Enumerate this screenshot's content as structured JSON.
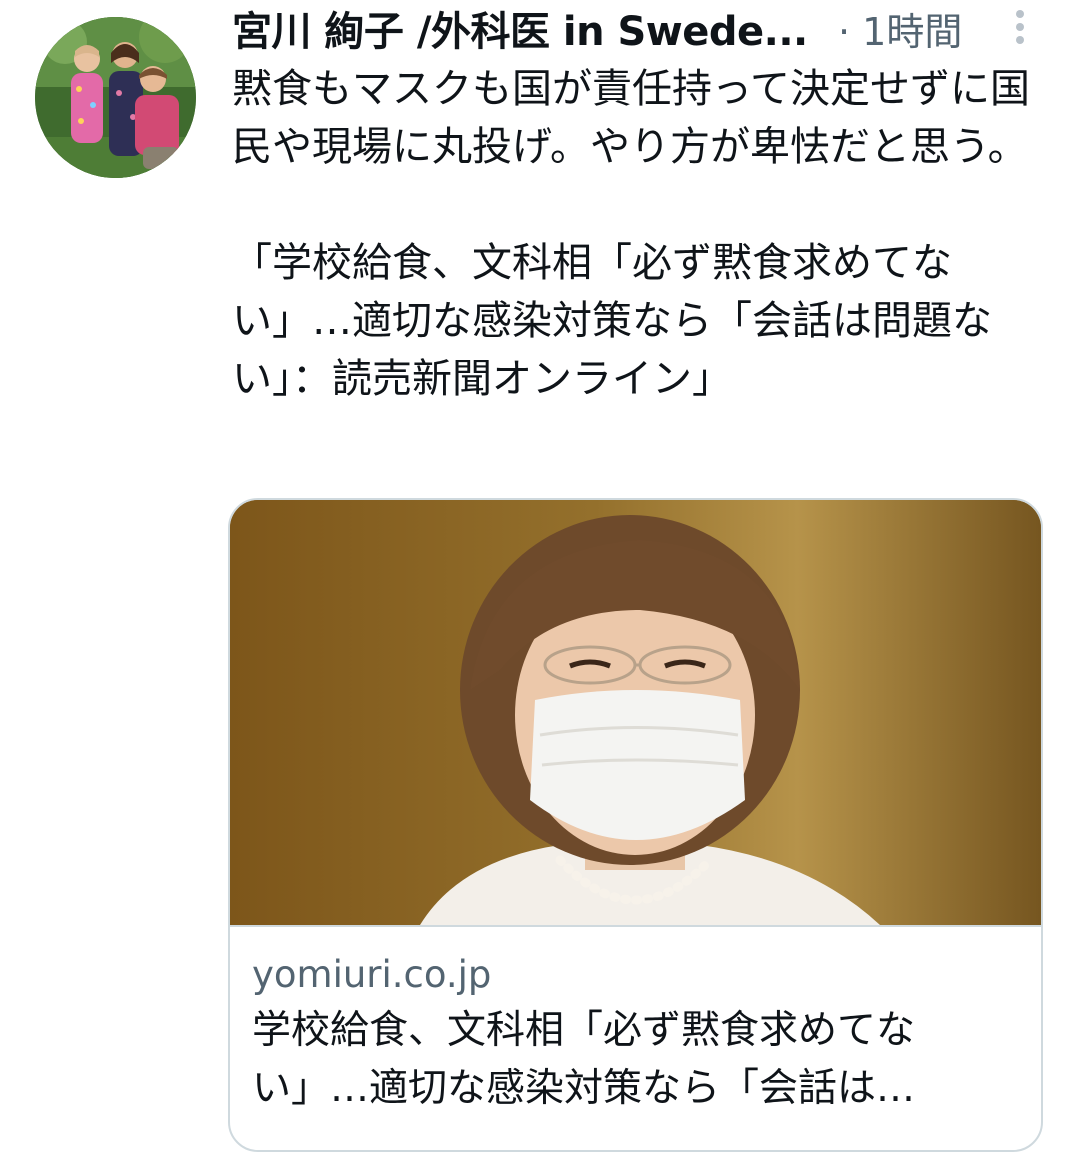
{
  "author": {
    "display_name": "宮川 絢子 /外科医 in Swede...",
    "timestamp": "· 1時間"
  },
  "tweet": {
    "line_1": "黙食もマスクも国が責任持って決定せずに国民や現場に丸投げ。やり方が卑怯だと思う。",
    "line_2": "「学校給食、文科相「必ず黙食求めてない」…適切な感染対策なら「会話は問題ない」：読売新聞オンライン」"
  },
  "card": {
    "domain": "yomiuri.co.jp",
    "title": "学校給食、文科相「必ず黙食求めてない」…適切な感染対策なら「会話は…"
  },
  "icons": {
    "more": "more-vertical-icon",
    "avatar": "profile-photo"
  },
  "colors": {
    "text_primary": "#0f1419",
    "text_secondary": "#536471",
    "border": "#cfd9de"
  }
}
